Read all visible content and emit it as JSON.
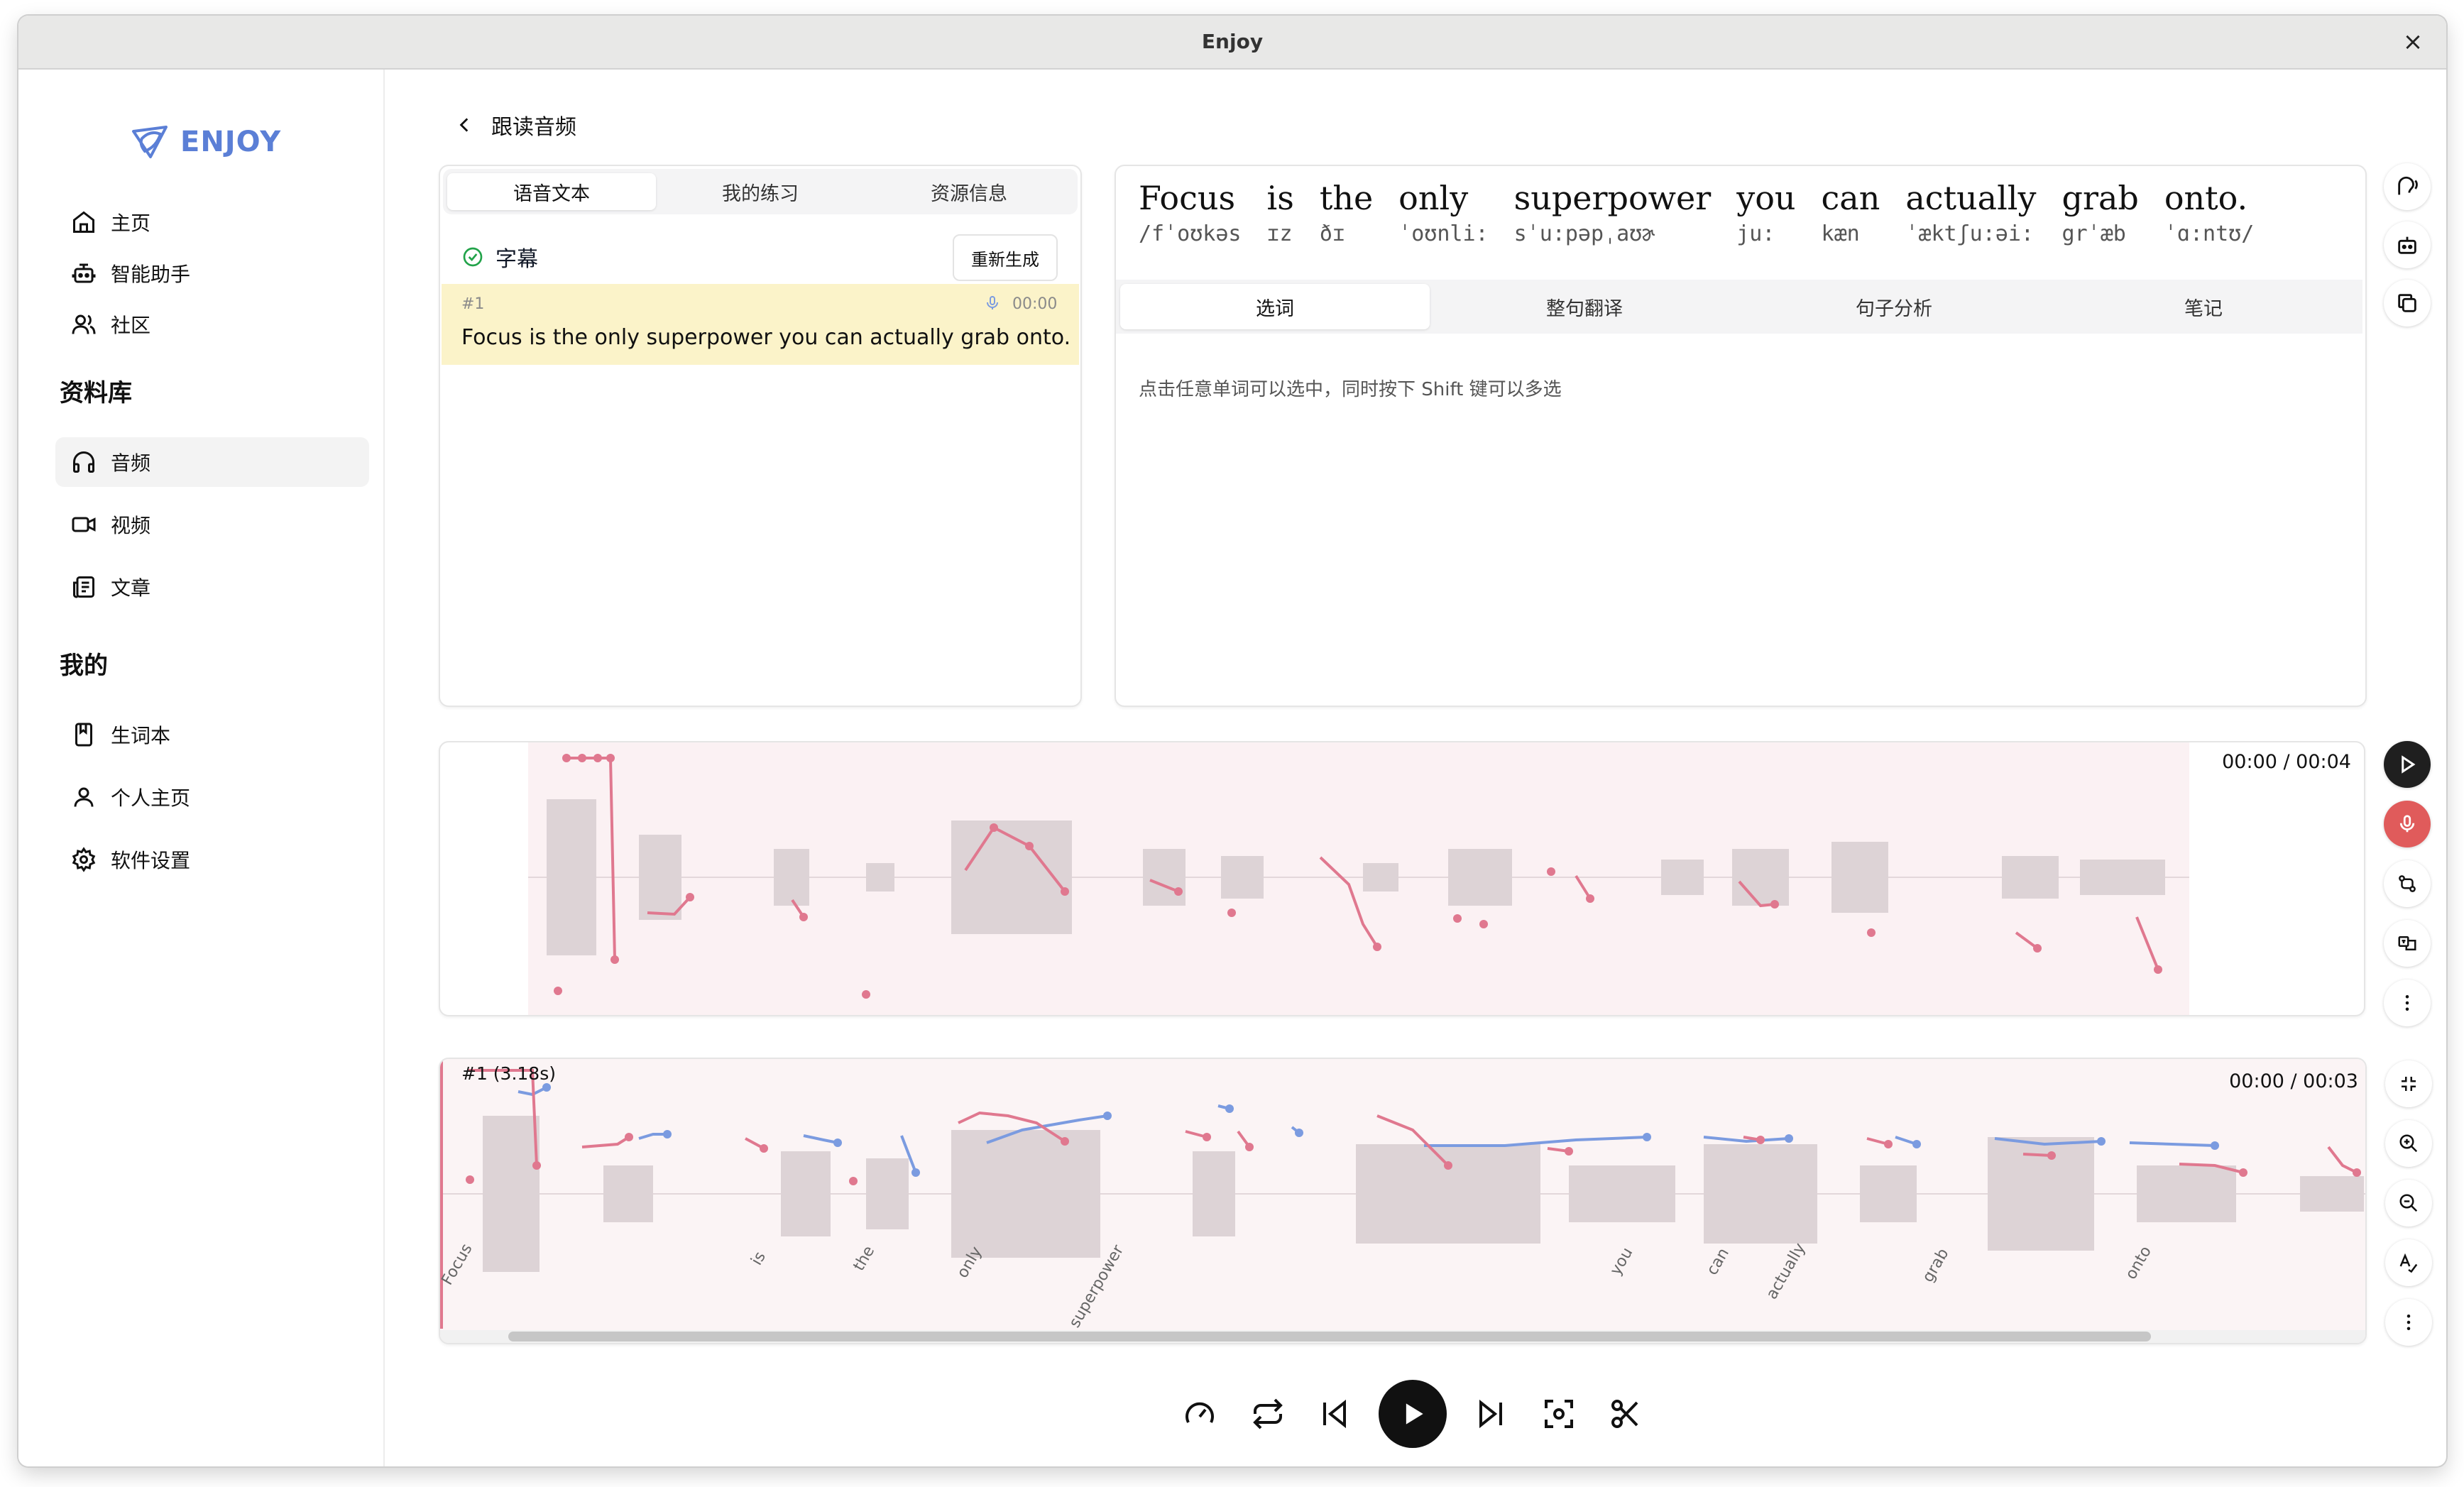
{
  "window": {
    "title": "Enjoy",
    "close_glyph": "×"
  },
  "app": {
    "logo_text": "ENJOY"
  },
  "sidebar": {
    "top_items": [
      {
        "label": "主页",
        "icon": "home-icon"
      },
      {
        "label": "智能助手",
        "icon": "bot-icon"
      },
      {
        "label": "社区",
        "icon": "users-icon"
      }
    ],
    "library_title": "资料库",
    "library_items": [
      {
        "label": "音频",
        "icon": "headphones-icon",
        "active": true
      },
      {
        "label": "视频",
        "icon": "video-icon"
      },
      {
        "label": "文章",
        "icon": "newspaper-icon"
      }
    ],
    "mine_title": "我的",
    "mine_items": [
      {
        "label": "生词本",
        "icon": "notebook-icon"
      },
      {
        "label": "个人主页",
        "icon": "user-icon"
      },
      {
        "label": "软件设置",
        "icon": "gear-icon"
      }
    ]
  },
  "breadcrumb": {
    "title": "跟读音频"
  },
  "left_panel": {
    "tabs": [
      "语音文本",
      "我的练习",
      "资源信息"
    ],
    "active_tab": "语音文本",
    "caption_title": "字幕",
    "regenerate_label": "重新生成",
    "segment": {
      "index": "#1",
      "time": "00:00",
      "text": "Focus is the only superpower you can actually grab onto."
    }
  },
  "right_panel": {
    "words": [
      {
        "word": "Focus",
        "ipa": "/fˈoʊkəs"
      },
      {
        "word": "is",
        "ipa": "ɪz"
      },
      {
        "word": "the",
        "ipa": "ðɪ"
      },
      {
        "word": "only",
        "ipa": "ˈoʊnli:"
      },
      {
        "word": "superpower",
        "ipa": "sˈu:pəpˌaʊɚ"
      },
      {
        "word": "you",
        "ipa": "ju:"
      },
      {
        "word": "can",
        "ipa": "kæn"
      },
      {
        "word": "actually",
        "ipa": "ˈæktʃu:əi:"
      },
      {
        "word": "grab",
        "ipa": "grˈæb"
      },
      {
        "word": "onto.",
        "ipa": "ˈɑ:ntʊ/"
      }
    ],
    "tabs": [
      "选词",
      "整句翻译",
      "句子分析",
      "笔记"
    ],
    "active_tab": "选词",
    "hint": "点击任意单词可以选中，同时按下 Shift 键可以多选"
  },
  "waveform_top": {
    "time": "00:00 / 00:04"
  },
  "waveform_bottom": {
    "segment_label": "#1 (3.18s)",
    "time": "00:00 / 00:03",
    "word_labels": [
      "Focus",
      "is",
      "the",
      "only",
      "superpower",
      "you",
      "can",
      "actually",
      "grab",
      "onto"
    ]
  },
  "side_toolbar_icons": [
    "speaker-icon",
    "bot-icon",
    "copy-icon"
  ],
  "waveform_tools_top": [
    "play-icon",
    "microphone-icon",
    "compare-icon",
    "translate-icon",
    "more-icon"
  ],
  "waveform_tools_bottom": [
    "shrink-icon",
    "zoom-in-icon",
    "zoom-out-icon",
    "spell-icon",
    "more-icon"
  ],
  "player_controls": [
    "speed-icon",
    "repeat-icon",
    "previous-icon",
    "play-icon",
    "next-icon",
    "focus-icon",
    "scissors-icon"
  ],
  "colors": {
    "accent": "#5b7fd6",
    "pitch_user": "#e0788f",
    "pitch_ref": "#7b9be0",
    "highlight": "#fbf3c9",
    "record": "#e05b5b"
  }
}
